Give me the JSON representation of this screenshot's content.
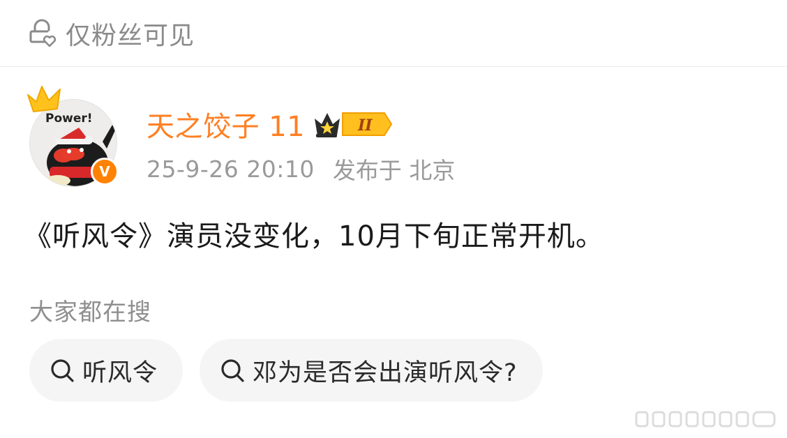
{
  "visibility": {
    "label": "仅粉丝可见",
    "icon": "lock-heart-icon"
  },
  "author": {
    "name": "天之饺子 11",
    "avatar_text": "Power!",
    "badge_level": "II",
    "verified": true,
    "name_color": "#ff7f23"
  },
  "meta": {
    "time": "25-9-26 20:10",
    "source": "发布于 北京"
  },
  "post": {
    "text": "《听风令》演员没变化，10月下旬正常开机。"
  },
  "hot_search": {
    "title": "大家都在搜",
    "chips": [
      {
        "label": "听风令",
        "icon": "search-icon"
      },
      {
        "label": "邓为是否会出演听风令?",
        "icon": "search-icon"
      }
    ]
  },
  "colors": {
    "accent": "#ff7f23",
    "verified": "#ff8200",
    "muted": "#8a8a8a"
  }
}
